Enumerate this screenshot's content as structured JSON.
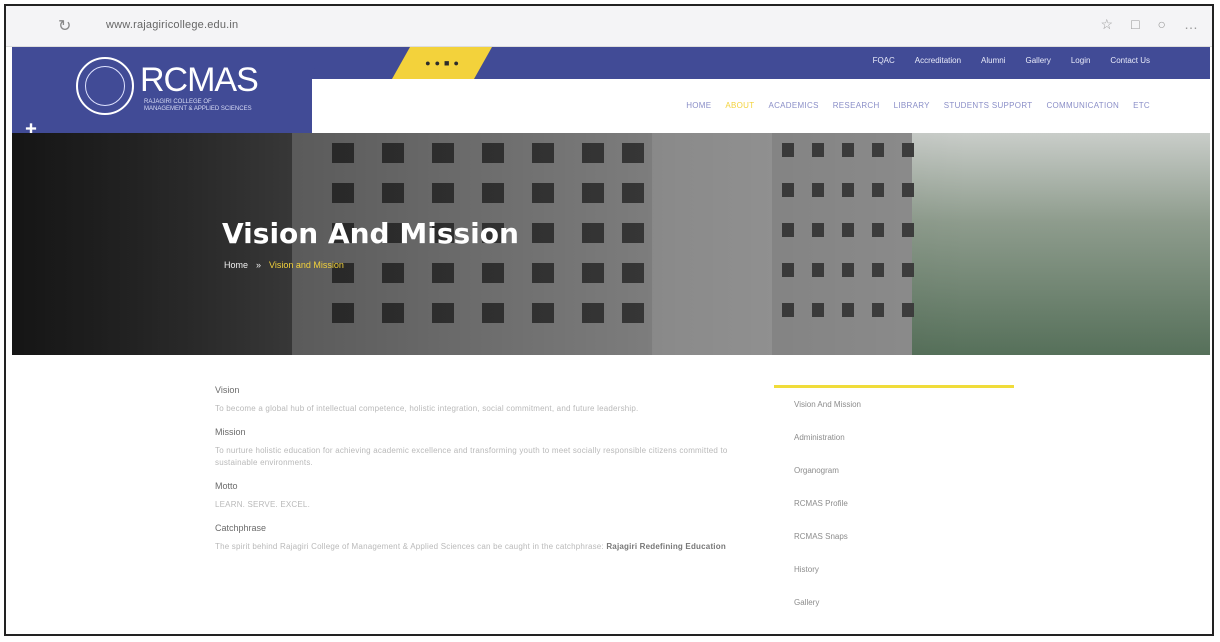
{
  "browser": {
    "url": "https://www.rajagirimanagement.ac.in/vision-and-mission",
    "url_host": "www.rajagiricollege.edu.in"
  },
  "logo": {
    "text": "RCMAS",
    "sub": "RAJAGIRI COLLEGE OF MANAGEMENT & APPLIED SCIENCES"
  },
  "topbar": {
    "links": [
      "FQAC",
      "Accreditation",
      "Alumni",
      "Gallery",
      "Login",
      "Contact Us"
    ]
  },
  "nav": {
    "items": [
      "HOME",
      "ABOUT",
      "ACADEMICS",
      "RESEARCH",
      "LIBRARY",
      "STUDENTS SUPPORT",
      "COMMUNICATION",
      "ETC"
    ]
  },
  "hero": {
    "title": "Vision And Mission",
    "crumb_home": "Home",
    "crumb_sep": "»",
    "crumb_current": "Vision and Mission"
  },
  "content": {
    "vision_heading": "Vision",
    "vision_text": "To become a global hub of intellectual competence, holistic integration, social commitment, and future leadership.",
    "mission_heading": "Mission",
    "mission_text": "To nurture holistic education for achieving academic excellence and transforming youth to meet socially responsible citizens committed to sustainable environments.",
    "motto_heading": "Motto",
    "motto_text": "LEARN. SERVE. EXCEL.",
    "caption_heading": "Catchphrase",
    "caption_text": "The spirit behind Rajagiri College of Management & Applied Sciences can be caught in the catchphrase:",
    "caption_bold": "Rajagiri Redefining Education"
  },
  "sidebar": {
    "items": [
      "Vision And Mission",
      "Administration",
      "Organogram",
      "RCMAS Profile",
      "RCMAS Snaps",
      "History",
      "Gallery"
    ]
  }
}
